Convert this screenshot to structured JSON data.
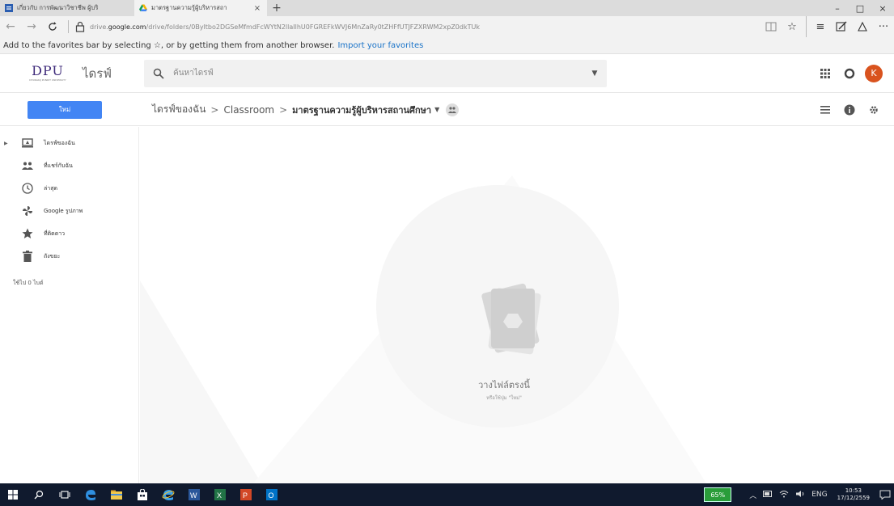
{
  "browser": {
    "tabs": [
      {
        "title": "เกี่ยวกับ การพัฒนาวิชาชีพ ผู้บริ",
        "active": false
      },
      {
        "title": "มาตรฐานความรู้ผู้บริหารสถา",
        "active": true
      }
    ],
    "close_glyph": "×",
    "new_tab_glyph": "+",
    "url_prefix": "drive.",
    "url_domain": "google.com",
    "url_path": "/drive/folders/0Byltbo2DGSeMfmdFcWYtN2llaIlhU0FGREFkWVJ6MnZaRy0tZHFfUTJFZXRWM2xpZ0dkTUk",
    "window_controls": [
      "–",
      "□",
      "×"
    ]
  },
  "favorites_bar": {
    "message": "Add to the favorites bar by selecting ☆, or by getting them from another browser.",
    "import_link": "Import your favorites"
  },
  "drive": {
    "logo_text": "DPU",
    "logo_sub": "DHURAKIJ PUNDIT UNIVERSITY",
    "product_name": "ไดรฟ์",
    "search_placeholder": "ค้นหาไดรฟ์",
    "avatar_letter": "K",
    "new_button": "ใหม่",
    "breadcrumb": [
      "ไดรฟ์ของฉัน",
      "Classroom",
      "มาตรฐานความรู้ผู้บริหารสถานศึกษา"
    ],
    "breadcrumb_sep": ">",
    "sidebar": [
      {
        "label": "ไดรฟ์ของฉัน",
        "icon": "drive-icon"
      },
      {
        "label": "ที่แชร์กับฉัน",
        "icon": "shared-people-icon"
      },
      {
        "label": "ล่าสุด",
        "icon": "clock-icon"
      },
      {
        "label": "Google รูปภาพ",
        "icon": "photos-pinwheel-icon"
      },
      {
        "label": "ที่ติดดาว",
        "icon": "star-icon"
      },
      {
        "label": "ถังขยะ",
        "icon": "trash-icon"
      }
    ],
    "storage": "ใช้ไป 0 ไบต์",
    "empty_title": "วางไฟล์ตรงนี้",
    "empty_sub": "หรือใช้ปุ่ม \"ใหม่\""
  },
  "taskbar": {
    "battery": "65%",
    "lang": "ENG",
    "time": "10:53",
    "date": "17/12/2559"
  },
  "colors": {
    "accent": "#4285f4",
    "avatar": "#d9531e",
    "taskbar": "#101a2e",
    "battery": "#2a9d3a"
  }
}
